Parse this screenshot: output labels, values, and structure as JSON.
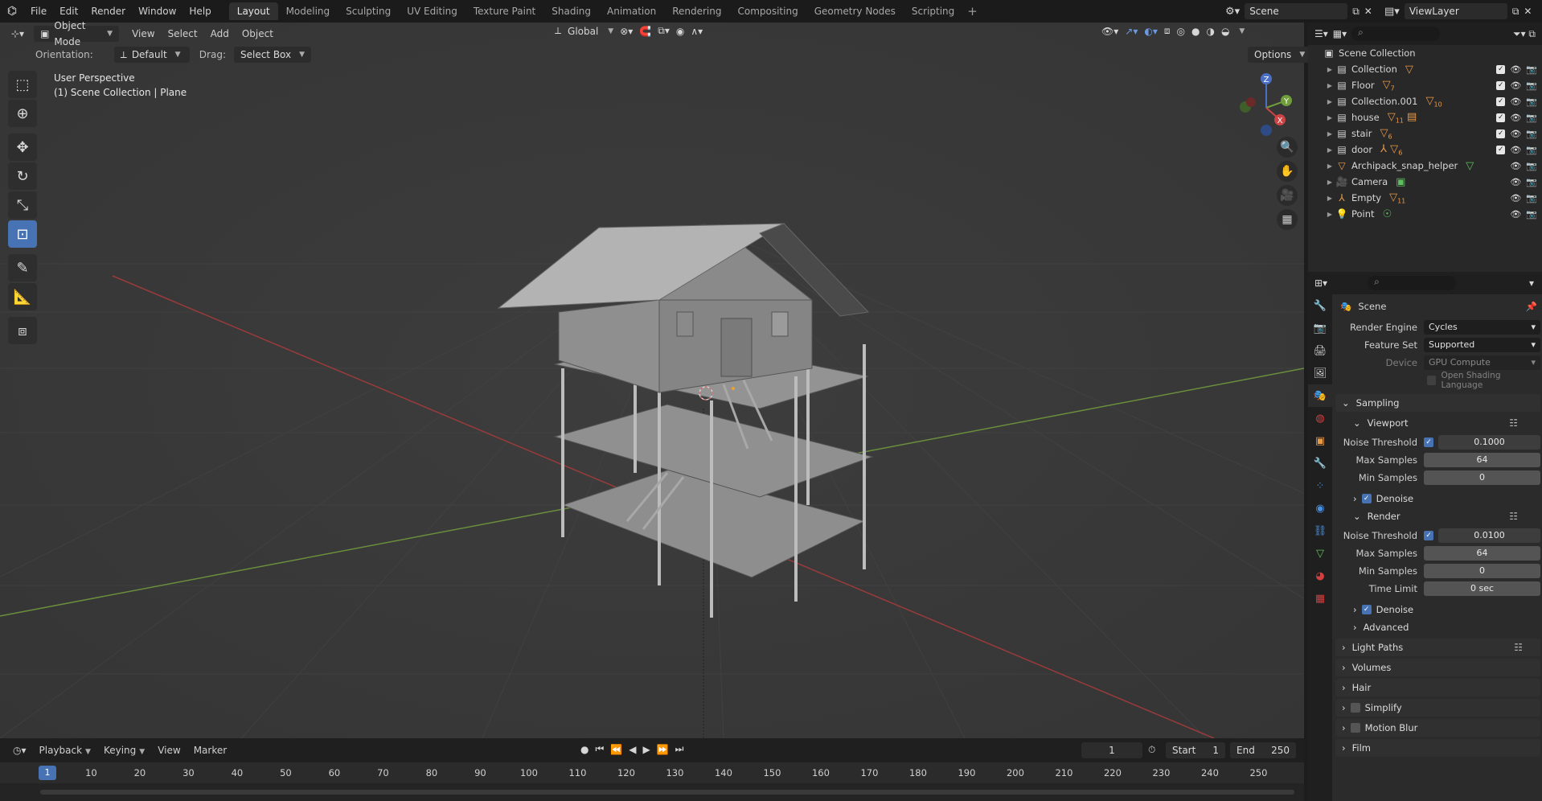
{
  "topbar": {
    "menus": [
      "File",
      "Edit",
      "Render",
      "Window",
      "Help"
    ],
    "workspaces": [
      "Layout",
      "Modeling",
      "Sculpting",
      "UV Editing",
      "Texture Paint",
      "Shading",
      "Animation",
      "Rendering",
      "Compositing",
      "Geometry Nodes",
      "Scripting"
    ],
    "scene": "Scene",
    "view_layer": "ViewLayer"
  },
  "viewport": {
    "mode": "Object Mode",
    "menus": [
      "View",
      "Select",
      "Add",
      "Object"
    ],
    "transform_orientation": "Global",
    "orientation_label": "Orientation:",
    "orientation_value": "Default",
    "drag_label": "Drag:",
    "drag_value": "Select Box",
    "options_label": "Options",
    "info_line1": "User Perspective",
    "info_line2": "(1) Scene Collection | Plane",
    "gizmo": {
      "x": "X",
      "y": "Y",
      "z": "Z"
    }
  },
  "outliner": {
    "root": "Scene Collection",
    "items": [
      {
        "name": "Collection",
        "icon": "collection-icon",
        "badge": ""
      },
      {
        "name": "Floor",
        "icon": "collection-icon",
        "badge": "7"
      },
      {
        "name": "Collection.001",
        "icon": "collection-icon",
        "badge": "10"
      },
      {
        "name": "house",
        "icon": "collection-icon",
        "badge": "11"
      },
      {
        "name": "stair",
        "icon": "collection-icon",
        "badge": "6"
      },
      {
        "name": "door",
        "icon": "collection-icon",
        "badge": "6"
      },
      {
        "name": "Archipack_snap_helper",
        "icon": "mesh-icon",
        "badge": ""
      },
      {
        "name": "Camera",
        "icon": "camera-icon",
        "badge": ""
      },
      {
        "name": "Empty",
        "icon": "empty-icon",
        "badge": "11"
      },
      {
        "name": "Point",
        "icon": "light-icon",
        "badge": ""
      }
    ]
  },
  "properties": {
    "context": "Scene",
    "render_engine_label": "Render Engine",
    "render_engine": "Cycles",
    "feature_set_label": "Feature Set",
    "feature_set": "Supported",
    "device_label": "Device",
    "device": "GPU Compute",
    "osl_label": "Open Shading Language",
    "sampling": "Sampling",
    "viewport_label": "Viewport",
    "noise_threshold_label": "Noise Threshold",
    "vp_noise_threshold": "0.1000",
    "max_samples_label": "Max Samples",
    "vp_max_samples": "64",
    "min_samples_label": "Min Samples",
    "vp_min_samples": "0",
    "denoise_label": "Denoise",
    "render_label": "Render",
    "r_noise_threshold": "0.0100",
    "r_max_samples": "64",
    "r_min_samples": "0",
    "time_limit_label": "Time Limit",
    "r_time_limit": "0 sec",
    "advanced_label": "Advanced",
    "light_paths": "Light Paths",
    "volumes": "Volumes",
    "hair": "Hair",
    "simplify": "Simplify",
    "motion_blur": "Motion Blur",
    "film": "Film"
  },
  "timeline": {
    "menus": [
      "Playback",
      "Keying",
      "View",
      "Marker"
    ],
    "current_frame": "1",
    "start_label": "Start",
    "start": "1",
    "end_label": "End",
    "end": "250",
    "ticks": [
      "10",
      "20",
      "30",
      "40",
      "50",
      "60",
      "70",
      "80",
      "90",
      "100",
      "110",
      "120",
      "130",
      "140",
      "150",
      "160",
      "170",
      "180",
      "190",
      "200",
      "210",
      "220",
      "230",
      "240",
      "250"
    ]
  }
}
